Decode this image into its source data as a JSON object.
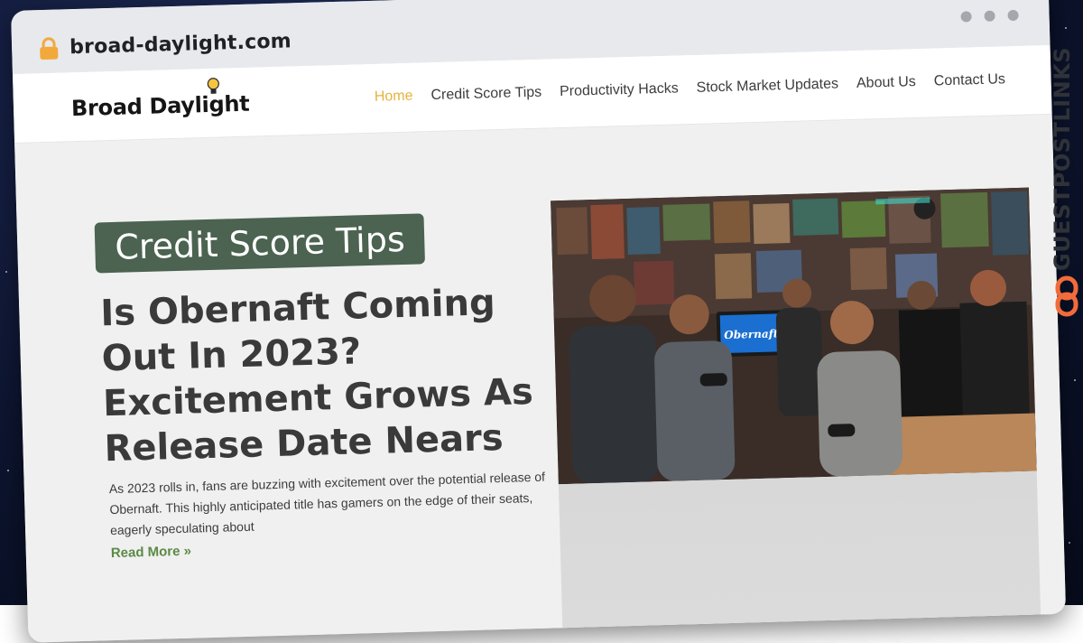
{
  "browser": {
    "url": "broad-daylight.com",
    "lock_icon": "lock-icon",
    "window_dots": 3
  },
  "site": {
    "logo_text": "Broad Daylight",
    "logo_icon": "lightbulb-icon",
    "nav": [
      {
        "label": "Home",
        "active": true
      },
      {
        "label": "Credit Score Tips",
        "active": false
      },
      {
        "label": "Productivity Hacks",
        "active": false
      },
      {
        "label": "Stock Market Updates",
        "active": false
      },
      {
        "label": "About Us",
        "active": false
      },
      {
        "label": "Contact Us",
        "active": false
      }
    ]
  },
  "article": {
    "category": "Credit Score Tips",
    "title": "Is Obernaft Coming Out In 2023? Excitement Grows As Release Date Nears",
    "excerpt": "As 2023 rolls in, fans are buzzing with excitement over the potential release of Obernaft. This highly anticipated title has gamers on the edge of their seats, eagerly speculating about",
    "read_more": "Read More »",
    "image_icon": "game-room-photo"
  },
  "watermark": {
    "text": "GUESTPOSTLINKS",
    "icon": "chain-link-icon"
  },
  "colors": {
    "nav_active": "#e6b33e",
    "badge_bg": "#4b6350",
    "read_more": "#5b8a45",
    "watermark_accent": "#f26b3a"
  }
}
